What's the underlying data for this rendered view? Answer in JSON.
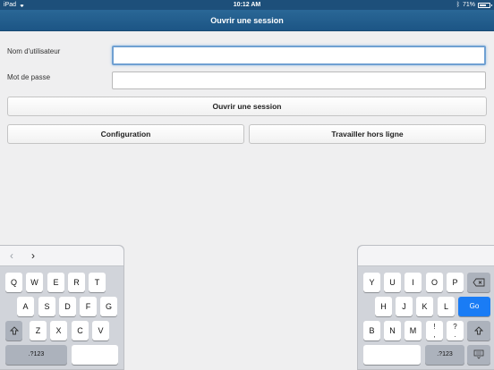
{
  "status": {
    "device": "iPad",
    "time": "10:12 AM",
    "battery": "71%",
    "battery_level": 0.71
  },
  "header": {
    "title": "Ouvrir une session"
  },
  "form": {
    "username_label": "Nom d'utilisateur",
    "username_value": "",
    "password_label": "Mot de passe",
    "password_value": ""
  },
  "buttons": {
    "login": "Ouvrir une session",
    "configuration": "Configuration",
    "offline": "Travailler hors ligne"
  },
  "keyboard": {
    "left_row1": [
      "Q",
      "W",
      "E",
      "R",
      "T"
    ],
    "left_row2": [
      "A",
      "S",
      "D",
      "F",
      "G"
    ],
    "left_row3": [
      "Z",
      "X",
      "C",
      "V"
    ],
    "right_row1": [
      "Y",
      "U",
      "I",
      "O",
      "P"
    ],
    "right_row2": [
      "H",
      "J",
      "K",
      "L"
    ],
    "right_row3": [
      "B",
      "N",
      "M"
    ],
    "go": "Go",
    "numbers": ".?123",
    "exclam": [
      "!",
      ","
    ],
    "question": [
      "?",
      "."
    ]
  }
}
